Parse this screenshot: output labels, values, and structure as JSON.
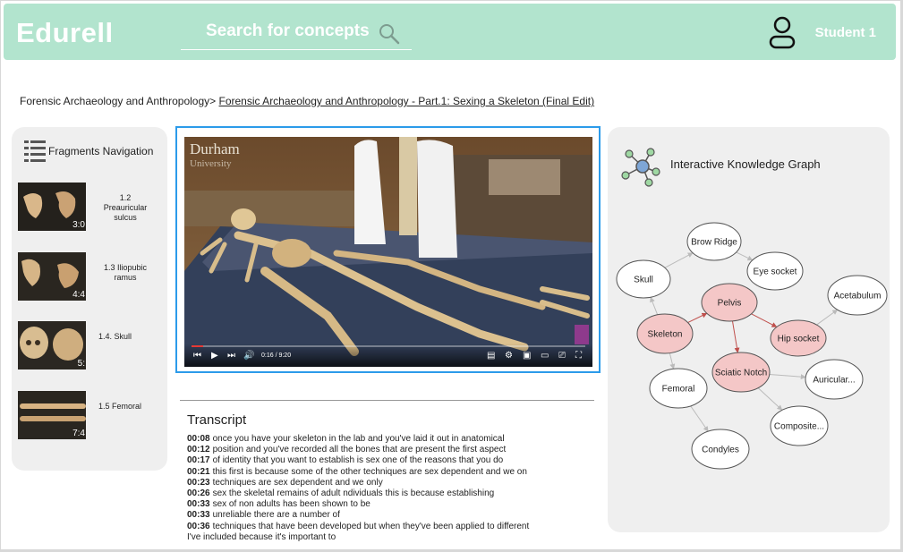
{
  "header": {
    "logo": "Edurell",
    "search_placeholder": "Search for concepts",
    "user_name": "Student 1"
  },
  "breadcrumb": {
    "parent": "Forensic Archaeology and Anthropology>",
    "current": "Forensic Archaeology and Anthropology - Part.1: Sexing a Skeleton (Final Edit)"
  },
  "fragments": {
    "title": "Fragments Navigation",
    "items": [
      {
        "label": "1.2 Preauricular sulcus",
        "duration": "3:0"
      },
      {
        "label": "1.3 Iliopubic ramus",
        "duration": "4:4"
      },
      {
        "label": "1.4.  Skull",
        "duration": "5:"
      },
      {
        "label": "1.5  Femoral",
        "duration": "7:4"
      }
    ]
  },
  "video": {
    "watermark_line1": "Durham",
    "watermark_line2": "University",
    "time": "0:16 / 9:20",
    "progress_percent": 3
  },
  "transcript": {
    "title": "Transcript",
    "lines": [
      {
        "time": "00:08",
        "text": "once you have your skeleton in the lab and you've laid it out in anatomical"
      },
      {
        "time": "00:12",
        "text": "position and you've recorded all the bones that are present the first aspect"
      },
      {
        "time": "00:17",
        "text": "of identity that you want to establish is sex one of the reasons that you do"
      },
      {
        "time": "00:21",
        "text": "this first is because some of the other techniques are sex dependent and we on"
      },
      {
        "time": "00:23",
        "text": "techniques are sex dependent and we only"
      },
      {
        "time": "00:26",
        "text": "sex the skeletal remains of adult ndividuals this is because establishing"
      },
      {
        "time": "00:33",
        "text": "sex of non adults has been shown to be"
      },
      {
        "time": "00:33",
        "text": "unreliable there are a number of"
      },
      {
        "time": "00:36",
        "text": "techniques that have been developed but when they've been applied to different"
      },
      {
        "time": "",
        "text": "I've included because it's important to"
      }
    ]
  },
  "knowledge_graph": {
    "title": "Interactive Knowledge Graph",
    "colors": {
      "highlight_fill": "#f4c7c7",
      "normal_fill": "#ffffff",
      "edge": "#bbbbbb",
      "highlight_edge": "#c0504d"
    },
    "nodes": [
      {
        "id": "brow-ridge",
        "label": "Brow Ridge",
        "highlight": false
      },
      {
        "id": "skull",
        "label": "Skull",
        "highlight": false
      },
      {
        "id": "eye-socket",
        "label": "Eye socket",
        "highlight": false
      },
      {
        "id": "pelvis",
        "label": "Pelvis",
        "highlight": true
      },
      {
        "id": "acetabulum",
        "label": "Acetabulum",
        "highlight": false
      },
      {
        "id": "skeleton",
        "label": "Skeleton",
        "highlight": true
      },
      {
        "id": "hip-socket",
        "label": "Hip socket",
        "highlight": true
      },
      {
        "id": "sciatic-notch",
        "label": "Sciatic Notch",
        "highlight": true
      },
      {
        "id": "femoral",
        "label": "Femoral",
        "highlight": false
      },
      {
        "id": "auricular",
        "label": "Auricular...",
        "highlight": false
      },
      {
        "id": "composite",
        "label": "Composite...",
        "highlight": false
      },
      {
        "id": "condyles",
        "label": "Condyles",
        "highlight": false
      }
    ],
    "edges": [
      {
        "from": "skull",
        "to": "brow-ridge"
      },
      {
        "from": "brow-ridge",
        "to": "eye-socket"
      },
      {
        "from": "skeleton",
        "to": "skull"
      },
      {
        "from": "skeleton",
        "to": "pelvis"
      },
      {
        "from": "pelvis",
        "to": "hip-socket"
      },
      {
        "from": "hip-socket",
        "to": "acetabulum"
      },
      {
        "from": "pelvis",
        "to": "sciatic-notch"
      },
      {
        "from": "sciatic-notch",
        "to": "auricular"
      },
      {
        "from": "sciatic-notch",
        "to": "composite"
      },
      {
        "from": "skeleton",
        "to": "femoral"
      },
      {
        "from": "femoral",
        "to": "condyles"
      }
    ]
  }
}
